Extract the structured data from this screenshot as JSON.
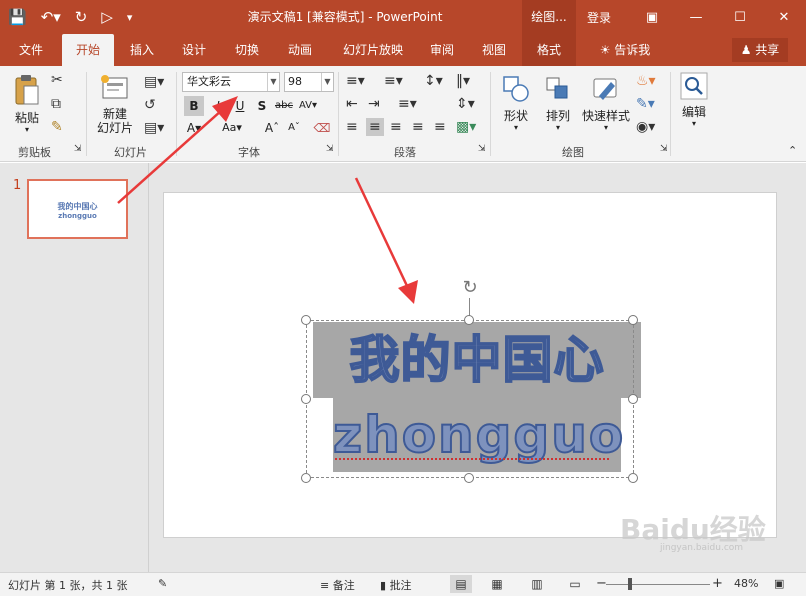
{
  "titlebar": {
    "title": "演示文稿1 [兼容模式] - PowerPoint",
    "context_tab": "绘图...",
    "login": "登录",
    "qat_icons": [
      "save-icon",
      "undo-icon",
      "redo-icon",
      "present-icon",
      "customize-icon"
    ]
  },
  "tabs": [
    "文件",
    "开始",
    "插入",
    "设计",
    "切换",
    "动画",
    "幻灯片放映",
    "审阅",
    "视图",
    "格式"
  ],
  "tell_me": "告诉我",
  "share": "共享",
  "ribbon": {
    "clipboard": {
      "paste": "粘贴",
      "label": "剪贴板"
    },
    "slides": {
      "new_slide_1": "新建",
      "new_slide_2": "幻灯片",
      "label": "幻灯片"
    },
    "font": {
      "font_name": "华文彩云",
      "font_size": "98",
      "label": "字体"
    },
    "paragraph": {
      "label": "段落"
    },
    "drawing": {
      "shapes": "形状",
      "arrange": "排列",
      "quick_styles": "快速样式",
      "label": "绘图"
    },
    "editing": {
      "label": "编辑"
    }
  },
  "thumbnail": {
    "number": "1",
    "line1": "我的中国心",
    "line2": "zhongguo"
  },
  "slide": {
    "line1": "我的中国心",
    "line2": "zhongguo"
  },
  "status": {
    "slide_info": "幻灯片 第 1 张，共 1 张",
    "notes": "备注",
    "comments": "批注",
    "zoom": "48%"
  },
  "watermark": {
    "text": "Baidu经验",
    "url": "jingyan.baidu.com"
  },
  "colors": {
    "accent": "#b7472a",
    "text_fill": "#7e92bd",
    "text_outline": "#3e5a96"
  }
}
